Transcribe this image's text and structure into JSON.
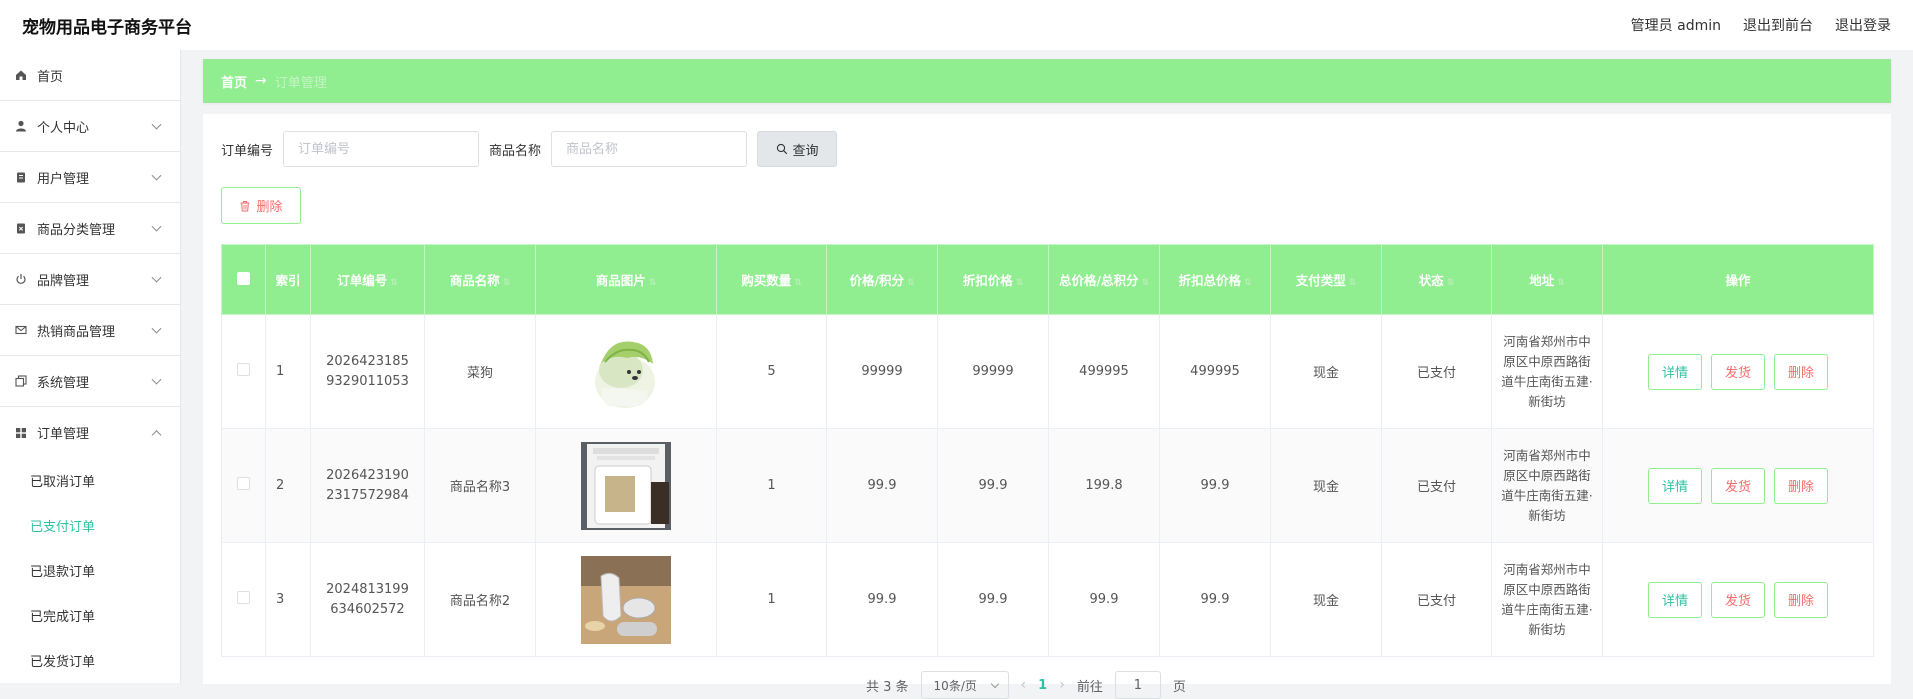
{
  "header": {
    "title": "宠物用品电子商务平台",
    "user": "管理员 admin",
    "front_link": "退出到前台",
    "logout": "退出登录"
  },
  "sidebar": {
    "items": [
      {
        "label": "首页",
        "icon": "home-icon"
      },
      {
        "label": "个人中心",
        "icon": "user-icon"
      },
      {
        "label": "用户管理",
        "icon": "clipboard-icon"
      },
      {
        "label": "商品分类管理",
        "icon": "clipboard-x-icon"
      },
      {
        "label": "品牌管理",
        "icon": "power-icon"
      },
      {
        "label": "热销商品管理",
        "icon": "mail-icon"
      },
      {
        "label": "系统管理",
        "icon": "copy-icon"
      },
      {
        "label": "订单管理",
        "icon": "grid-icon"
      }
    ],
    "sub_items": [
      "已取消订单",
      "已支付订单",
      "已退款订单",
      "已完成订单",
      "已发货订单"
    ],
    "active_sub": "已支付订单"
  },
  "breadcrumb": {
    "home": "首页",
    "arrow": "→",
    "current": "订单管理"
  },
  "search": {
    "order_label": "订单编号",
    "order_placeholder": "订单编号",
    "name_label": "商品名称",
    "name_placeholder": "商品名称",
    "query_button": "查询"
  },
  "delete_button": "删除",
  "table": {
    "headers": [
      "索引",
      "订单编号",
      "商品名称",
      "商品图片",
      "购买数量",
      "价格/积分",
      "折扣价格",
      "总价格/总积分",
      "折扣总价格",
      "支付类型",
      "状态",
      "地址",
      "操作"
    ],
    "rows": [
      {
        "index": "1",
        "order_no": "20264231859329011053",
        "name": "菜狗",
        "qty": "5",
        "price": "99999",
        "discount": "99999",
        "total": "499995",
        "discount_total": "499995",
        "pay": "现金",
        "status": "已支付",
        "address": "河南省郑州市中原区中原西路街道牛庄南街五建·新街坊"
      },
      {
        "index": "2",
        "order_no": "20264231902317572984",
        "name": "商品名称3",
        "qty": "1",
        "price": "99.9",
        "discount": "99.9",
        "total": "199.8",
        "discount_total": "99.9",
        "pay": "现金",
        "status": "已支付",
        "address": "河南省郑州市中原区中原西路街道牛庄南街五建·新街坊"
      },
      {
        "index": "3",
        "order_no": "2024813199634602572",
        "name": "商品名称2",
        "qty": "1",
        "price": "99.9",
        "discount": "99.9",
        "total": "99.9",
        "discount_total": "99.9",
        "pay": "现金",
        "status": "已支付",
        "address": "河南省郑州市中原区中原西路街道牛庄南街五建·新街坊"
      }
    ],
    "ops": {
      "detail": "详情",
      "ship": "发货",
      "delete": "删除"
    }
  },
  "pagination": {
    "total": "共 3 条",
    "page_size": "10条/页",
    "prev": "‹",
    "current_page": "1",
    "next": "›",
    "goto_label": "前往",
    "goto_value": "1",
    "goto_suffix": "页"
  },
  "colors": {
    "accent_green": "#90ee90",
    "active_teal": "#31c0a3",
    "danger_red": "#f56c6c"
  }
}
